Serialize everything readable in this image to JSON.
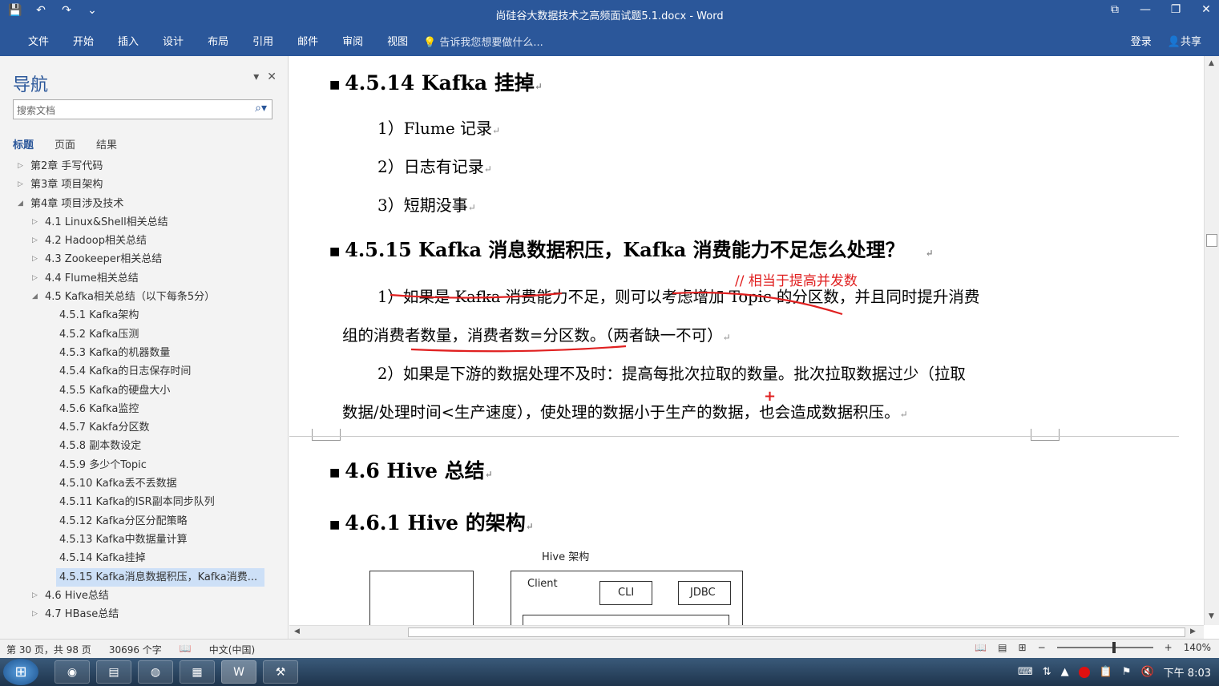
{
  "window": {
    "title": "尚硅谷大数据技术之高频面试题5.1.docx - Word",
    "qat": [
      "save-icon",
      "undo-icon",
      "redo-icon",
      "customize-icon"
    ],
    "qat_glyphs": [
      "💾",
      "↶",
      "↷",
      "⌄"
    ]
  },
  "ribbon": {
    "tabs": [
      "文件",
      "开始",
      "插入",
      "设计",
      "布局",
      "引用",
      "邮件",
      "审阅",
      "视图"
    ],
    "tell_me": "告诉我您想要做什么...",
    "login": "登录",
    "share": "共享"
  },
  "nav": {
    "title": "导航",
    "search_placeholder": "搜索文档",
    "tabs": [
      "标题",
      "页面",
      "结果"
    ],
    "tree": [
      {
        "label": "第2章 手写代码",
        "level": 0,
        "arrow": "▷"
      },
      {
        "label": "第3章 项目架构",
        "level": 0,
        "arrow": "▷"
      },
      {
        "label": "第4章 项目涉及技术",
        "level": 0,
        "arrow": "◢"
      },
      {
        "label": "4.1 Linux&Shell相关总结",
        "level": 1,
        "arrow": "▷"
      },
      {
        "label": "4.2 Hadoop相关总结",
        "level": 1,
        "arrow": "▷"
      },
      {
        "label": "4.3 Zookeeper相关总结",
        "level": 1,
        "arrow": "▷"
      },
      {
        "label": "4.4 Flume相关总结",
        "level": 1,
        "arrow": "▷"
      },
      {
        "label": "4.5 Kafka相关总结（以下每条5分）",
        "level": 1,
        "arrow": "◢"
      },
      {
        "label": "4.5.1 Kafka架构",
        "level": 2,
        "arrow": ""
      },
      {
        "label": "4.5.2 Kafka压测",
        "level": 2,
        "arrow": ""
      },
      {
        "label": "4.5.3 Kafka的机器数量",
        "level": 2,
        "arrow": ""
      },
      {
        "label": "4.5.4 Kafka的日志保存时间",
        "level": 2,
        "arrow": ""
      },
      {
        "label": "4.5.5 Kafka的硬盘大小",
        "level": 2,
        "arrow": ""
      },
      {
        "label": "4.5.6 Kafka监控",
        "level": 2,
        "arrow": ""
      },
      {
        "label": "4.5.7 Kakfa分区数",
        "level": 2,
        "arrow": ""
      },
      {
        "label": "4.5.8 副本数设定",
        "level": 2,
        "arrow": ""
      },
      {
        "label": "4.5.9 多少个Topic",
        "level": 2,
        "arrow": ""
      },
      {
        "label": "4.5.10 Kafka丢不丢数据",
        "level": 2,
        "arrow": ""
      },
      {
        "label": "4.5.11 Kafka的ISR副本同步队列",
        "level": 2,
        "arrow": ""
      },
      {
        "label": "4.5.12 Kafka分区分配策略",
        "level": 2,
        "arrow": ""
      },
      {
        "label": "4.5.13 Kafka中数据量计算",
        "level": 2,
        "arrow": ""
      },
      {
        "label": "4.5.14 Kafka挂掉",
        "level": 2,
        "arrow": ""
      },
      {
        "label": "4.5.15 Kafka消息数据积压，Kafka消费...",
        "level": 2,
        "arrow": "",
        "selected": true
      },
      {
        "label": "4.6 Hive总结",
        "level": 1,
        "arrow": "▷"
      },
      {
        "label": "4.7 HBase总结",
        "level": 1,
        "arrow": "▷"
      }
    ]
  },
  "doc": {
    "h_4514": "4.5.14 Kafka 挂掉",
    "p1": "1）Flume 记录",
    "p2": "2）日志有记录",
    "p3": "3）短期没事",
    "h_4515": "4.5.15 Kafka 消息数据积压，Kafka 消费能力不足怎么处理？",
    "annotation": "// 相当于提高并发数",
    "q1_line1": "1）如果是 Kafka 消费能力不足，则可以考虑增加 Topic 的分区数，并且同时提升消费",
    "q1_line2": "组的消费者数量，消费者数=分区数。（两者缺一不可）",
    "q2_line1": "2）如果是下游的数据处理不及时：提高每批次拉取的数量。批次拉取数据过少（拉取",
    "q2_line2": "数据/处理时间<生产速度），使处理的数据小于生产的数据，也会造成数据积压。",
    "h_46": "4.6 Hive 总结",
    "h_461": "4.6.1 Hive 的架构",
    "diagram_title": "Hive 架构",
    "client": "Client",
    "cli": "CLI",
    "jdbc": "JDBC",
    "para_mark": "↵",
    "bullet": "■",
    "cursor_mark": "+"
  },
  "status": {
    "page": "第 30 页，共 98 页",
    "words": "30696 个字",
    "language": "中文(中国)",
    "zoom": "140%",
    "zoom_level": 0.58
  },
  "taskbar": {
    "time": "下午 8:03",
    "apps": [
      "media-player-icon",
      "notepad-icon",
      "chrome-icon",
      "explorer-icon",
      "word-icon",
      "tool-icon"
    ],
    "app_glyphs": [
      "◉",
      "▤",
      "◍",
      "▦",
      "W",
      "⚒"
    ]
  },
  "colors": {
    "ribbon": "#2b579a",
    "annotation": "#e02020",
    "selected_nav": "#cde0f7"
  }
}
